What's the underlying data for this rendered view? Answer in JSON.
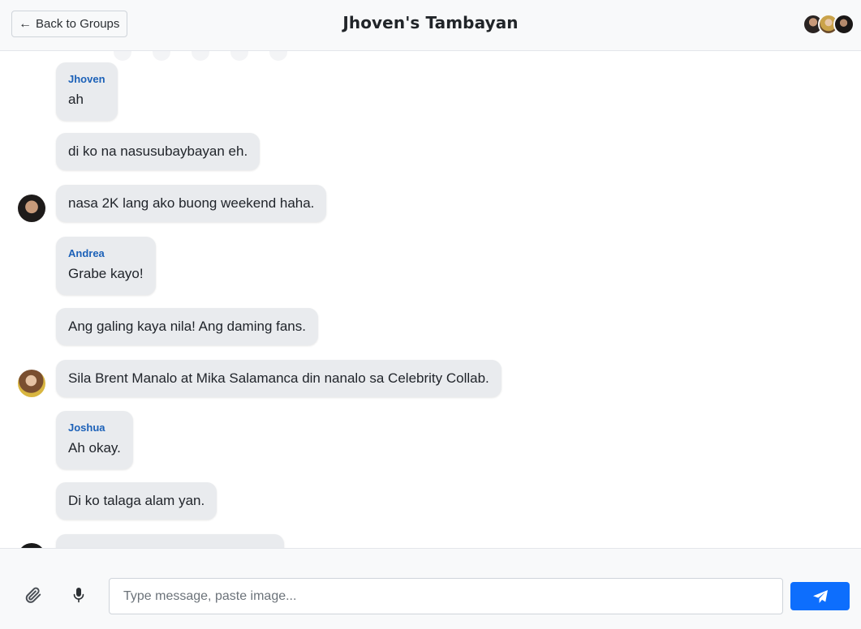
{
  "header": {
    "back_label": "Back to Groups",
    "title": "Jhoven's Tambayan",
    "member_avatars": [
      "avatar-1",
      "avatar-2",
      "avatar-3"
    ]
  },
  "messages": [
    {
      "sender": "Jhoven",
      "text": "ah"
    },
    {
      "sender": "",
      "text": "di ko na nasusubaybayan eh."
    },
    {
      "sender": "",
      "text": "nasa 2K lang ako buong weekend haha.",
      "avatar": "jhoven-avatar"
    },
    {
      "sender": "Andrea",
      "text": "Grabe kayo!"
    },
    {
      "sender": "",
      "text": "Ang galing kaya nila! Ang daming fans."
    },
    {
      "sender": "",
      "text": "Sila Brent Manalo at Mika Salamanca din nanalo sa Celebrity Collab.",
      "avatar": "andrea-avatar"
    },
    {
      "sender": "Joshua",
      "text": "Ah okay."
    },
    {
      "sender": "",
      "text": "Di ko talaga alam yan."
    }
  ],
  "composer": {
    "placeholder": "Type message, paste image...",
    "value": "",
    "icons": [
      "paperclip-icon",
      "microphone-icon",
      "send-icon"
    ]
  },
  "colors": {
    "accent": "#0d6efd",
    "sender_name": "#1c61b8",
    "bubble": "#e9ebee"
  }
}
